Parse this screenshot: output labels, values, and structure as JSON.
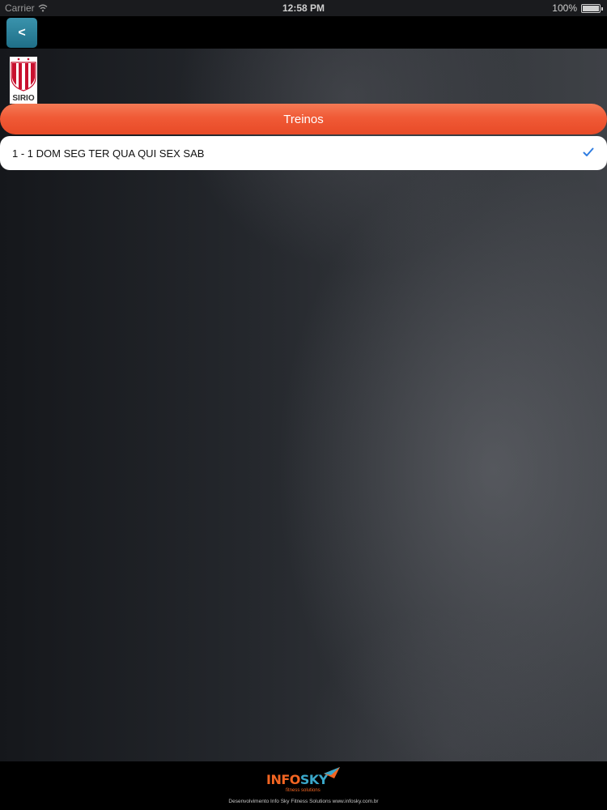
{
  "status_bar": {
    "carrier": "Carrier",
    "time": "12:58 PM",
    "battery": "100%"
  },
  "nav": {
    "back_label": "<"
  },
  "logo": {
    "text": "SIRIO"
  },
  "header": {
    "title": "Treinos"
  },
  "list": {
    "items": [
      {
        "label": "1 - 1 DOM SEG TER QUA QUI SEX SAB",
        "selected": true
      }
    ]
  },
  "footer": {
    "brand_primary": "INFO",
    "brand_secondary": "SKY",
    "brand_sub": "fitness solutions",
    "credit": "Desenvolvimento Info Sky Fitness Solutions www.infosky.com.br"
  },
  "colors": {
    "accent": "#f05a36",
    "back_button": "#2a82a0",
    "checkmark": "#2f7de1"
  }
}
